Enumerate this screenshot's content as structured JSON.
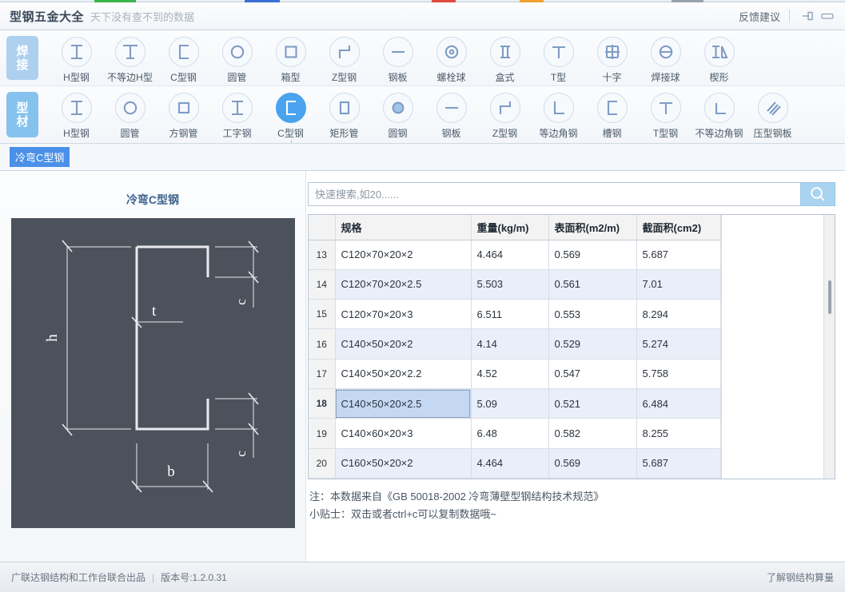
{
  "titlebar": {
    "app_title": "型钢五金大全",
    "subtitle": "天下没有查不到的数据",
    "feedback": "反馈建议",
    "pin_icon": "pin-icon",
    "minimize_icon": "minimize-icon"
  },
  "toolbar": {
    "rows": [
      {
        "category": "焊接",
        "items": [
          {
            "label": "H型钢",
            "icon": "h-beam-icon"
          },
          {
            "label": "不等边H型",
            "icon": "unequal-h-beam-icon"
          },
          {
            "label": "C型钢",
            "icon": "c-channel-icon"
          },
          {
            "label": "圆管",
            "icon": "round-pipe-icon"
          },
          {
            "label": "箱型",
            "icon": "box-section-icon"
          },
          {
            "label": "Z型钢",
            "icon": "z-section-icon"
          },
          {
            "label": "钢板",
            "icon": "steel-plate-icon"
          },
          {
            "label": "螺栓球",
            "icon": "bolt-ball-icon"
          },
          {
            "label": "盒式",
            "icon": "case-section-icon"
          },
          {
            "label": "T型",
            "icon": "t-section-icon"
          },
          {
            "label": "十字",
            "icon": "cross-section-icon"
          },
          {
            "label": "焊接球",
            "icon": "welded-ball-icon"
          },
          {
            "label": "楔形",
            "icon": "wedge-section-icon"
          }
        ]
      },
      {
        "category": "型材",
        "items": [
          {
            "label": "H型钢",
            "icon": "h-beam-icon"
          },
          {
            "label": "圆管",
            "icon": "round-pipe-icon"
          },
          {
            "label": "方钢管",
            "icon": "square-tube-icon"
          },
          {
            "label": "工字钢",
            "icon": "i-beam-icon"
          },
          {
            "label": "C型钢",
            "icon": "c-channel-icon",
            "selected": true
          },
          {
            "label": "矩形管",
            "icon": "rect-tube-icon"
          },
          {
            "label": "圆钢",
            "icon": "round-bar-icon"
          },
          {
            "label": "钢板",
            "icon": "steel-plate-icon"
          },
          {
            "label": "Z型钢",
            "icon": "z-section-icon"
          },
          {
            "label": "等边角钢",
            "icon": "equal-angle-icon"
          },
          {
            "label": "槽钢",
            "icon": "channel-icon"
          },
          {
            "label": "T型钢",
            "icon": "t-section-icon"
          },
          {
            "label": "不等边角钢",
            "icon": "unequal-angle-icon"
          },
          {
            "label": "压型钢板",
            "icon": "profiled-plate-icon"
          }
        ]
      }
    ]
  },
  "subtabs": [
    {
      "label": "冷弯C型钢",
      "selected": true
    }
  ],
  "diagram": {
    "title": "冷弯C型钢",
    "labels": {
      "h": "h",
      "b": "b",
      "t": "t",
      "c_top": "c",
      "c_bottom": "c"
    },
    "background_color": "#4b525c",
    "line_color": "#e8eaed"
  },
  "search": {
    "placeholder": "快速搜索,如20......",
    "value": "",
    "button_icon": "search-icon",
    "button_color": "#a9d4ef"
  },
  "table": {
    "headers": [
      "",
      "规格",
      "重量(kg/m)",
      "表面积(m2/m)",
      "截面积(cm2)"
    ],
    "rows": [
      {
        "index": "13",
        "spec": "C120×70×20×2",
        "weight": "4.464",
        "surface": "0.569",
        "section": "5.687"
      },
      {
        "index": "14",
        "spec": "C120×70×20×2.5",
        "weight": "5.503",
        "surface": "0.561",
        "section": "7.01"
      },
      {
        "index": "15",
        "spec": "C120×70×20×3",
        "weight": "6.511",
        "surface": "0.553",
        "section": "8.294"
      },
      {
        "index": "16",
        "spec": "C140×50×20×2",
        "weight": "4.14",
        "surface": "0.529",
        "section": "5.274"
      },
      {
        "index": "17",
        "spec": "C140×50×20×2.2",
        "weight": "4.52",
        "surface": "0.547",
        "section": "5.758"
      },
      {
        "index": "18",
        "spec": "C140×50×20×2.5",
        "weight": "5.09",
        "surface": "0.521",
        "section": "6.484",
        "selected": true
      },
      {
        "index": "19",
        "spec": "C140×60×20×3",
        "weight": "6.48",
        "surface": "0.582",
        "section": "8.255"
      },
      {
        "index": "20",
        "spec": "C160×50×20×2",
        "weight": "4.464",
        "surface": "0.569",
        "section": "5.687"
      }
    ]
  },
  "notes": {
    "source": "注：本数据来自《GB  50018-2002  冷弯薄壁型钢结构技术规范》",
    "tip": "小贴士：双击或者ctrl+c可以复制数据哦~"
  },
  "statusbar": {
    "producer": "广联达钢结构和工作台联合出品",
    "separator": "|",
    "version": "版本号:1.2.0.31",
    "right_link": "了解钢结构算量"
  }
}
